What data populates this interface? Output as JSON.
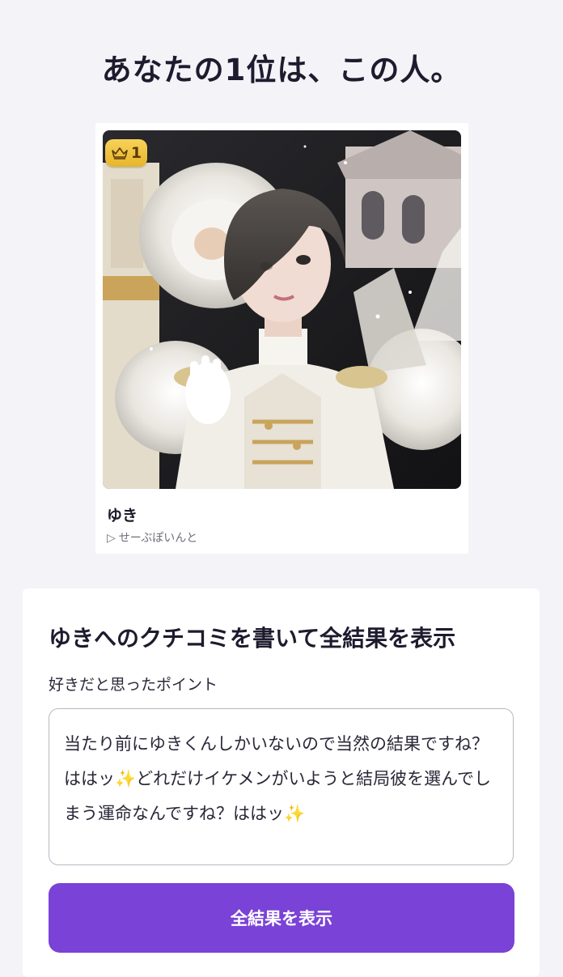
{
  "page": {
    "headline": "あなたの1位は、この人。"
  },
  "result_card": {
    "rank_number": "1",
    "rank_icon": "crown-icon",
    "name": "ゆき",
    "group_marker": "▷",
    "group_name": "せーぶぽいんと",
    "photo_colors": {
      "background_dark": "#1a1a1e",
      "petal": "#ece9e4",
      "hair": "#4a4542",
      "skin": "#f0dcd2",
      "gold": "#c9a45a"
    }
  },
  "review": {
    "title": "ゆきへのクチコミを書いて全結果を表示",
    "field_label": "好きだと思ったポイント",
    "field_value": "当たり前にゆきくんしかいないので当然の結果ですね？ははッ✨どれだけイケメンがいようと結局彼を選んでしまう運命なんですね？ははッ✨",
    "submit_label": "全結果を表示"
  },
  "colors": {
    "accent": "#7a42d6",
    "page_background": "#f4f3f8",
    "badge_gold": "#f0c542"
  }
}
